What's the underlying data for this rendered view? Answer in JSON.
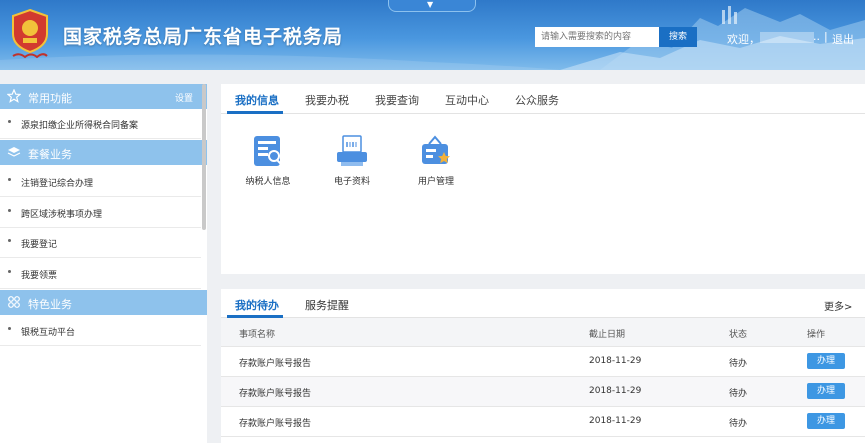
{
  "header": {
    "title": "国家税务总局广东省电子税务局",
    "pull_tab_glyph": "▼",
    "search_placeholder": "请输入需要搜索的内容",
    "search_button": "搜索",
    "welcome": "欢迎，",
    "user_suffix": "..",
    "separator": "|",
    "logout": "退出",
    "colors": {
      "bar": "#3b88d8",
      "search_button": "#1a6fc4"
    }
  },
  "sidebar": {
    "sections": [
      {
        "icon": "star-icon",
        "label": "常用功能",
        "action": "设置",
        "items": [
          "源泉扣缴企业所得税合同备案"
        ]
      },
      {
        "icon": "layers-icon",
        "label": "套餐业务",
        "items": [
          "注销登记综合办理",
          "跨区域涉税事项办理",
          "我要登记",
          "我要领票"
        ]
      },
      {
        "icon": "grid-icon",
        "label": "特色业务",
        "items": [
          "银税互动平台"
        ]
      }
    ],
    "header_color": "#8ec2ec"
  },
  "main_tabs": {
    "items": [
      "我的信息",
      "我要办税",
      "我要查询",
      "互动中心",
      "公众服务"
    ],
    "active": "我的信息",
    "tiles": [
      {
        "icon": "taxpayer-info-icon",
        "label": "纳税人信息"
      },
      {
        "icon": "e-document-icon",
        "label": "电子资料"
      },
      {
        "icon": "user-management-icon",
        "label": "用户管理"
      }
    ]
  },
  "todo": {
    "tabs": [
      "我的待办",
      "服务提醒"
    ],
    "active": "我的待办",
    "more": "更多>",
    "columns": [
      "事项名称",
      "截止日期",
      "状态",
      "操作"
    ],
    "rows": [
      {
        "name": "存款账户账号报告",
        "deadline": "2018-11-29",
        "status": "待办",
        "action": "办理"
      },
      {
        "name": "存款账户账号报告",
        "deadline": "2018-11-29",
        "status": "待办",
        "action": "办理"
      },
      {
        "name": "存款账户账号报告",
        "deadline": "2018-11-29",
        "status": "待办",
        "action": "办理"
      }
    ],
    "accent": "#1a6fc4"
  }
}
